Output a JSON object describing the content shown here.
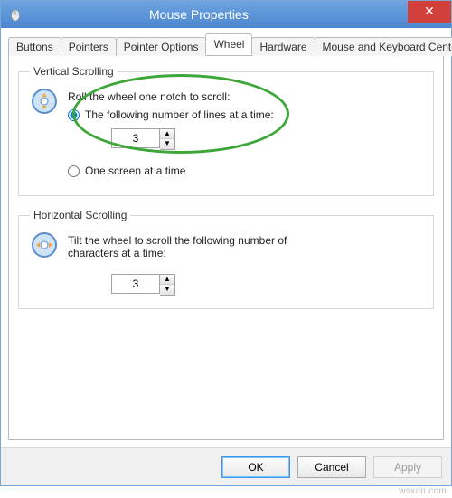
{
  "window": {
    "title": "Mouse Properties"
  },
  "tabs": {
    "items": [
      {
        "label": "Buttons"
      },
      {
        "label": "Pointers"
      },
      {
        "label": "Pointer Options"
      },
      {
        "label": "Wheel"
      },
      {
        "label": "Hardware"
      },
      {
        "label": "Mouse and Keyboard Center"
      }
    ],
    "active_index": 3
  },
  "vertical": {
    "legend": "Vertical Scrolling",
    "intro": "Roll the wheel one notch to scroll:",
    "opt_lines_label": "The following number of lines at a time:",
    "opt_screen_label": "One screen at a time",
    "lines_value": "3",
    "selected": "lines"
  },
  "horizontal": {
    "legend": "Horizontal Scrolling",
    "intro": "Tilt the wheel to scroll the following number of characters at a time:",
    "chars_value": "3"
  },
  "buttons": {
    "ok": "OK",
    "cancel": "Cancel",
    "apply": "Apply"
  },
  "watermark": "wsxdn.com"
}
